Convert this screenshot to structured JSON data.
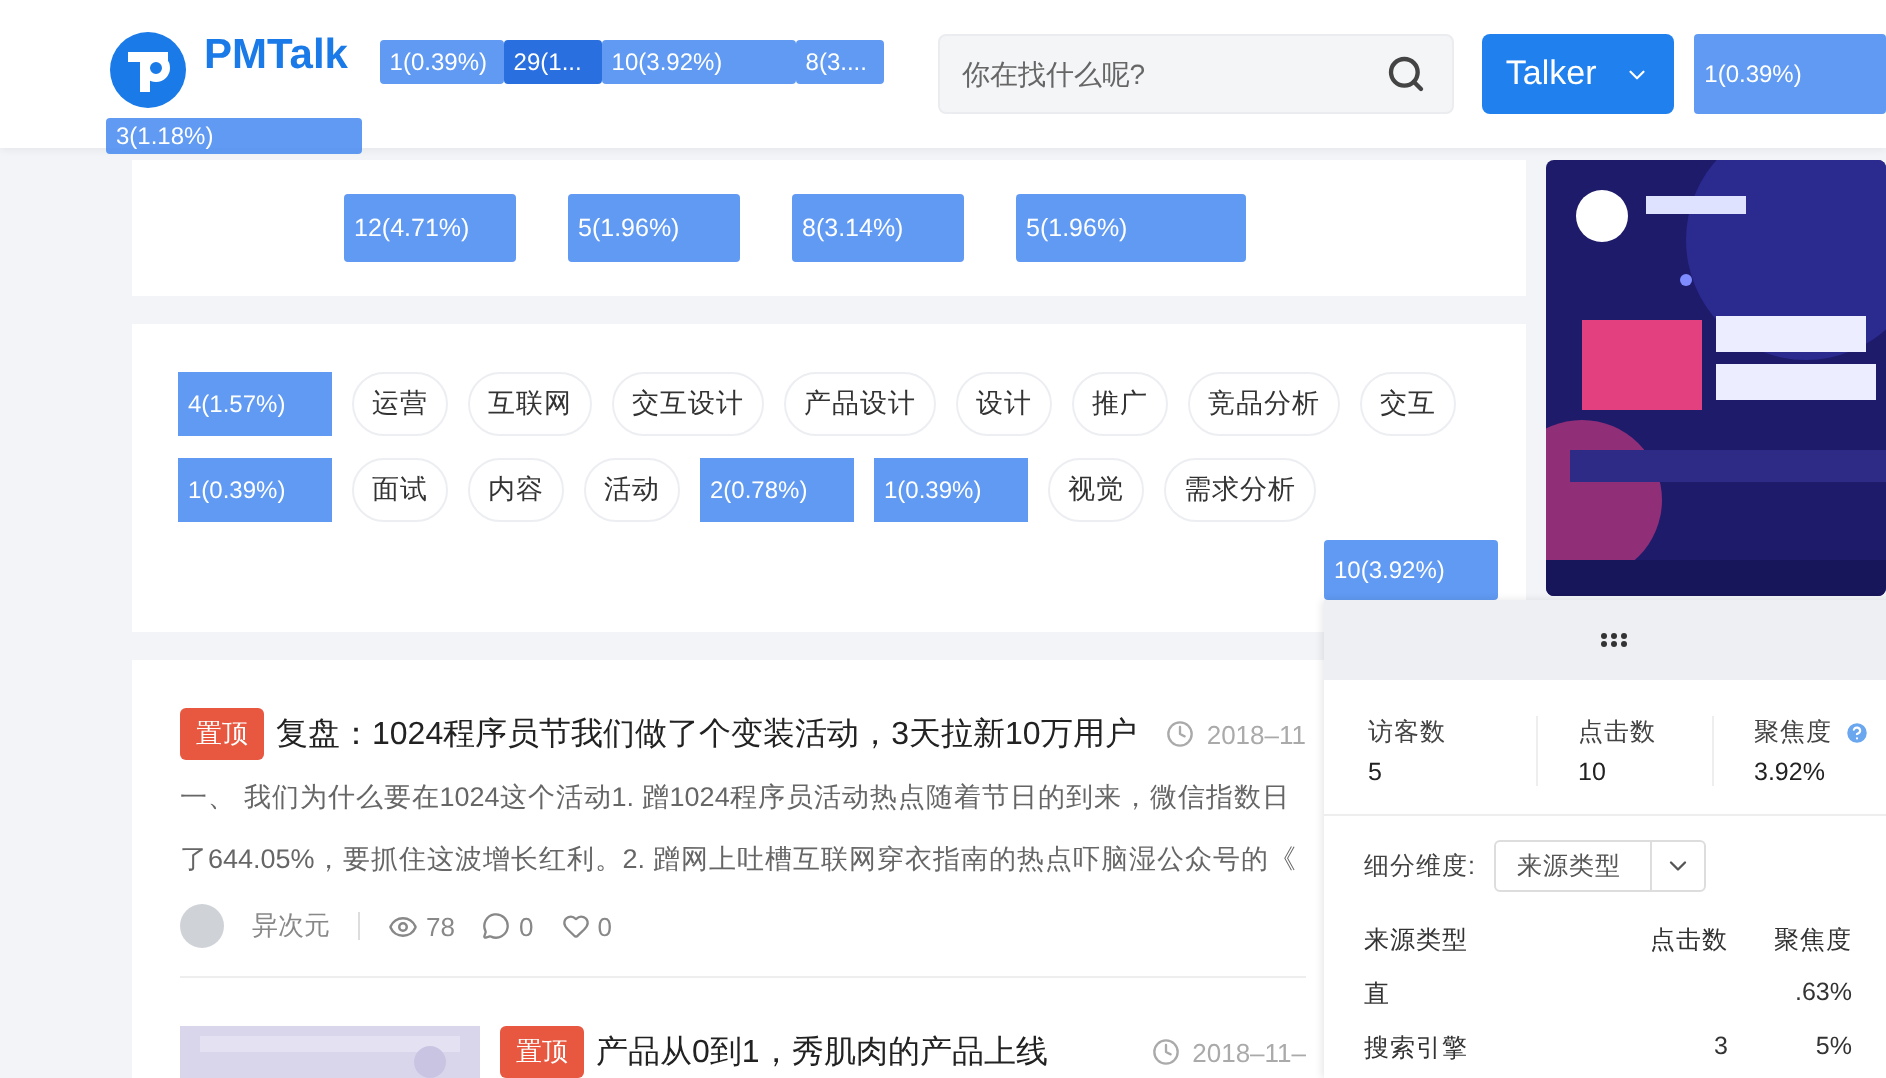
{
  "header": {
    "logo": "PMTalk",
    "logo_heat": "3(1.18%)",
    "nav_heat": [
      {
        "label": "1(0.39%)",
        "hot": false
      },
      {
        "label": "29(1...",
        "hot": true
      },
      {
        "label": "10(3.92%)",
        "hot": false
      },
      {
        "label": "8(3....",
        "hot": false
      }
    ],
    "search": {
      "placeholder": "你在找什么呢?"
    },
    "user_button": "Talker",
    "right_heat": "1(0.39%)"
  },
  "category_heat": [
    "12(4.71%)",
    "5(1.96%)",
    "8(3.14%)",
    "5(1.96%)"
  ],
  "tags": [
    {
      "kind": "heat",
      "label": "4(1.57%)"
    },
    {
      "kind": "tag",
      "label": "运营"
    },
    {
      "kind": "tag",
      "label": "互联网"
    },
    {
      "kind": "tag",
      "label": "交互设计"
    },
    {
      "kind": "tag",
      "label": "产品设计"
    },
    {
      "kind": "tag",
      "label": "设计"
    },
    {
      "kind": "tag",
      "label": "推广"
    },
    {
      "kind": "tag",
      "label": "竞品分析"
    },
    {
      "kind": "tag",
      "label": "交互"
    },
    {
      "kind": "heat",
      "label": "1(0.39%)"
    },
    {
      "kind": "tag",
      "label": "面试"
    },
    {
      "kind": "tag",
      "label": "内容"
    },
    {
      "kind": "tag",
      "label": "活动"
    },
    {
      "kind": "heat",
      "label": "2(0.78%)"
    },
    {
      "kind": "heat",
      "label": "1(0.39%)"
    },
    {
      "kind": "tag",
      "label": "视觉"
    },
    {
      "kind": "tag",
      "label": "需求分析"
    }
  ],
  "tags_overflow_heat": "10(3.92%)",
  "articles": [
    {
      "badge": "置顶",
      "title": "复盘：1024程序员节我们做了个变装活动，3天拉新10万用户",
      "date": "2018–11",
      "excerpt": [
        "一、 我们为什么要在1024这个活动1. 蹭1024程序员活动热点随着节日的到来，微信指数日",
        "了644.05%，要抓住这波增长红利。2. 蹭网上吐槽互联网穿衣指南的热点吓脑湿公众号的《"
      ],
      "author": "异次元",
      "views": "78",
      "comments": "0",
      "likes": "0"
    },
    {
      "badge": "置顶",
      "title": "产品从0到1，秀肌肉的产品上线",
      "date": "2018–11–"
    }
  ],
  "heat_panel": {
    "stats": [
      {
        "label": "访客数",
        "value": "5",
        "help": false
      },
      {
        "label": "点击数",
        "value": "10",
        "help": false
      },
      {
        "label": "聚焦度",
        "value": "3.92%",
        "help": true
      }
    ],
    "dimension_label": "细分维度:",
    "dimension_value": "来源类型",
    "columns": [
      "来源类型",
      "点击数",
      "聚焦度"
    ],
    "rows": [
      {
        "name": "直",
        "focus": ".63%"
      },
      {
        "name": "搜索引擎",
        "clicks": "3",
        "focus": "5%"
      }
    ]
  }
}
